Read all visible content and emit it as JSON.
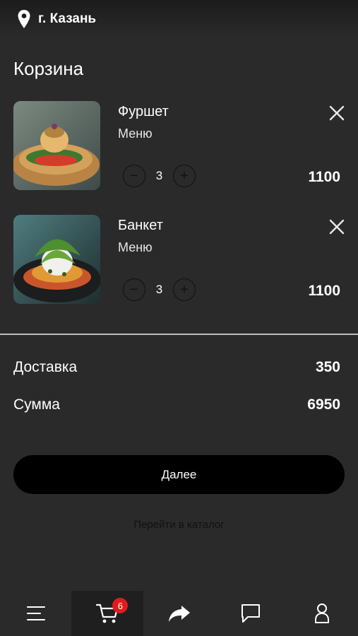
{
  "header": {
    "city": "г. Казань",
    "location_icon": "map-pin-icon"
  },
  "page": {
    "title": "Корзина"
  },
  "cart": {
    "items": [
      {
        "name": "Фуршет",
        "category": "Меню",
        "quantity": "3",
        "price": "1100",
        "minus": "−",
        "plus": "+"
      },
      {
        "name": "Банкет",
        "category": "Меню",
        "quantity": "3",
        "price": "1100",
        "minus": "−",
        "plus": "+"
      }
    ]
  },
  "summary": {
    "delivery_label": "Доставка",
    "delivery_value": "350",
    "total_label": "Сумма",
    "total_value": "6950"
  },
  "actions": {
    "next_label": "Далее",
    "catalog_label": "Перейти в каталог"
  },
  "nav": {
    "items": [
      "menu-icon",
      "cart-icon",
      "share-icon",
      "chat-icon",
      "profile-icon"
    ],
    "cart_badge": "6"
  },
  "colors": {
    "background": "#2a2a2b",
    "badge": "#e01b1b",
    "button": "#000000"
  }
}
